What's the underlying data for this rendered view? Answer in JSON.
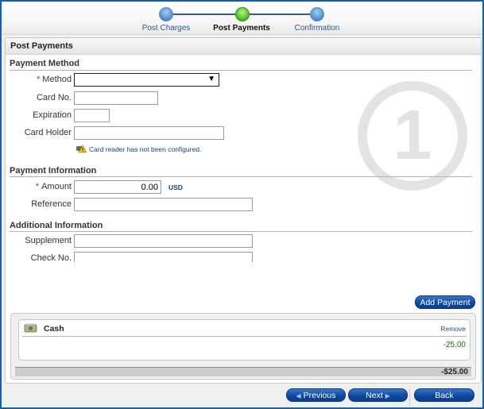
{
  "wizard": {
    "steps": [
      {
        "label": "Post Charges",
        "state": "complete"
      },
      {
        "label": "Post Payments",
        "state": "current"
      },
      {
        "label": "Confirmation",
        "state": "pending"
      }
    ]
  },
  "panel": {
    "title": "Post Payments",
    "step_number": "1"
  },
  "payment_method": {
    "section_title": "Payment Method",
    "method_label": "Method",
    "method_value": "",
    "card_no_label": "Card No.",
    "card_no_value": "",
    "expiration_label": "Expiration",
    "expiration_value": "",
    "card_holder_label": "Card Holder",
    "card_holder_value": "",
    "card_reader_notice": "Card reader has not been configured."
  },
  "payment_information": {
    "section_title": "Payment Information",
    "amount_label": "Amount",
    "amount_value": "0.00",
    "currency": "USD",
    "reference_label": "Reference",
    "reference_value": ""
  },
  "additional_information": {
    "section_title": "Additional Information",
    "supplement_label": "Supplement",
    "supplement_value": "",
    "check_no_label": "Check No.",
    "check_no_value": ""
  },
  "required_marker": "*",
  "actions": {
    "add_payment": "Add Payment",
    "previous": "Previous",
    "next": "Next",
    "back": "Back"
  },
  "payments": {
    "items": [
      {
        "method": "Cash",
        "remove_label": "Remove",
        "amount": "-25.00"
      }
    ],
    "total": "-$25.00"
  },
  "colors": {
    "accent": "#0f48a0",
    "current_step": "#48b81c",
    "other_step": "#4a8ad2",
    "required": "#d02020"
  }
}
